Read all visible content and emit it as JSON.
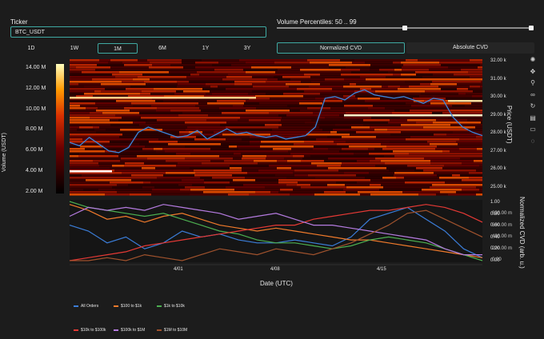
{
  "ticker": {
    "label": "Ticker",
    "value": "BTC_USDT"
  },
  "volume_percentiles": {
    "label": "Volume Percentiles: 50 .. 99",
    "low": 50,
    "high": 99
  },
  "ranges": [
    "1D",
    "1W",
    "1M",
    "6M",
    "1Y",
    "3Y"
  ],
  "active_range": "1M",
  "modes": {
    "normalized": "Normalized CVD",
    "absolute": "Absolute CVD",
    "active": "Normalized CVD"
  },
  "colorbar": {
    "title": "Volume (USDT)",
    "ticks": [
      "14.00 M",
      "12.00 M",
      "10.00 M",
      "8.00 M",
      "6.00 M",
      "4.00 M",
      "2.00 M"
    ]
  },
  "price_axis": {
    "title": "Price (USDT)",
    "ticks": [
      "32.00 k",
      "31.00 k",
      "30.00 k",
      "29.00 k",
      "28.00 k",
      "27.00 k",
      "26.00 k",
      "25.00 k"
    ]
  },
  "cvd_axis": {
    "title": "Normalized CVD (arb. u.)",
    "left_ticks": [
      "1.00",
      "0.80",
      "0.60",
      "0.40",
      "0.20",
      "0.00"
    ],
    "right_ticks": [
      "800.00 m",
      "600.00 m",
      "400.00 m",
      "200.00 m",
      "0.00"
    ]
  },
  "x_axis": {
    "title": "Date (UTC)",
    "ticks": [
      "4/01",
      "4/08",
      "4/15"
    ]
  },
  "toolbar": [
    "colorwheel-icon",
    "move-icon",
    "zoom-icon",
    "link-icon",
    "reset-icon",
    "save-icon",
    "comment-icon",
    "hover-icon"
  ],
  "chart_data": [
    {
      "type": "heatmap",
      "title": "",
      "xlabel": "Date (UTC)",
      "ylabel": "Price (USDT)",
      "ylim": [
        24500,
        32500
      ],
      "colorbar_label": "Volume (USDT)",
      "colorbar_range": [
        2000000,
        14500000
      ],
      "price_series": [
        27600,
        27400,
        27900,
        27500,
        27100,
        27000,
        27300,
        28200,
        28500,
        28300,
        28100,
        27900,
        28000,
        28300,
        27800,
        28100,
        28400,
        28100,
        28200,
        28000,
        27900,
        28000,
        27800,
        27900,
        28000,
        28500,
        30200,
        30300,
        30100,
        30500,
        30700,
        30400,
        30300,
        30200,
        30300,
        30100,
        29900,
        30200,
        30100,
        29100,
        28500,
        28200,
        28000
      ]
    },
    {
      "type": "line",
      "xlabel": "Date (UTC)",
      "ylabel": "Normalized CVD (arb. u.)",
      "ylim": [
        0,
        1
      ],
      "series": [
        {
          "name": "All Orders",
          "color": "#3b7dd8",
          "values": [
            0.6,
            0.5,
            0.3,
            0.4,
            0.2,
            0.3,
            0.5,
            0.4,
            0.45,
            0.35,
            0.3,
            0.3,
            0.35,
            0.3,
            0.25,
            0.4,
            0.7,
            0.8,
            0.9,
            0.7,
            0.5,
            0.2,
            0.05
          ]
        },
        {
          "name": "$100 to $1k",
          "color": "#f07a2b",
          "values": [
            0.95,
            0.85,
            0.7,
            0.75,
            0.65,
            0.75,
            0.8,
            0.7,
            0.6,
            0.55,
            0.5,
            0.55,
            0.5,
            0.45,
            0.4,
            0.35,
            0.35,
            0.3,
            0.25,
            0.2,
            0.15,
            0.1,
            0.05
          ]
        },
        {
          "name": "$1k to $10k",
          "color": "#4caf50",
          "values": [
            1.0,
            0.9,
            0.85,
            0.8,
            0.75,
            0.8,
            0.7,
            0.6,
            0.5,
            0.45,
            0.35,
            0.3,
            0.3,
            0.25,
            0.2,
            0.25,
            0.35,
            0.4,
            0.35,
            0.3,
            0.2,
            0.1,
            0.0
          ]
        },
        {
          "name": "$10k to $100k",
          "color": "#e53935",
          "values": [
            0.0,
            0.05,
            0.1,
            0.15,
            0.25,
            0.3,
            0.35,
            0.4,
            0.45,
            0.5,
            0.55,
            0.6,
            0.6,
            0.7,
            0.75,
            0.8,
            0.85,
            0.85,
            0.9,
            0.95,
            0.9,
            0.8,
            0.65
          ]
        },
        {
          "name": "$100k to $1M",
          "color": "#b57be0",
          "values": [
            0.75,
            0.9,
            0.85,
            0.9,
            0.85,
            0.95,
            0.9,
            0.85,
            0.8,
            0.7,
            0.75,
            0.8,
            0.7,
            0.6,
            0.6,
            0.55,
            0.5,
            0.45,
            0.4,
            0.35,
            0.2,
            0.1,
            0.1
          ]
        },
        {
          "name": "$1M to $10M",
          "color": "#a0522d",
          "values": [
            0.0,
            0.0,
            0.05,
            0.0,
            0.1,
            0.05,
            0.0,
            0.1,
            0.2,
            0.15,
            0.1,
            0.2,
            0.15,
            0.1,
            0.2,
            0.3,
            0.45,
            0.6,
            0.8,
            0.85,
            0.7,
            0.55,
            0.4
          ]
        }
      ]
    }
  ]
}
